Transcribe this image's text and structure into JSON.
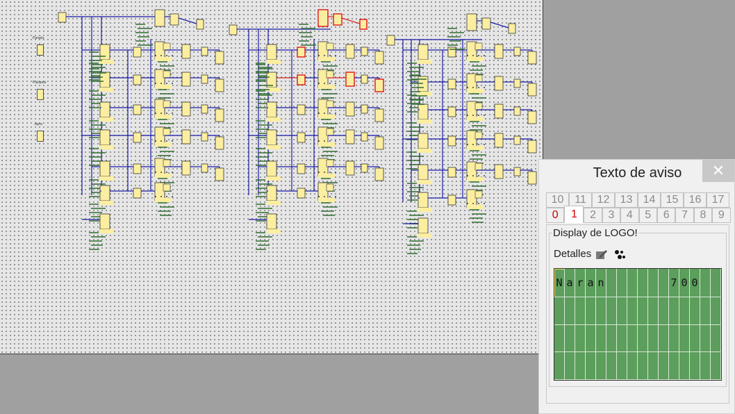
{
  "canvas": {
    "input_labels": [
      "Parada",
      "Pulsante",
      "Apoc"
    ],
    "colors": {
      "wire": "#1a1aa8",
      "active_wire": "#e02020",
      "block": "#fbeea0",
      "text": "#2e6b2e"
    }
  },
  "dialog": {
    "title": "Texto de aviso",
    "close_icon": "close-icon",
    "tabs_top": [
      "10",
      "11",
      "12",
      "13",
      "14",
      "15",
      "16",
      "17"
    ],
    "tabs_bottom": [
      "0",
      "1",
      "2",
      "3",
      "4",
      "5",
      "6",
      "7",
      "8",
      "9"
    ],
    "active_tab": "1",
    "group_label": "Display de LOGO!",
    "details_label": "Detalles",
    "lcd": {
      "rows": 4,
      "cols": 16,
      "line1": [
        "N",
        "a",
        "r",
        "a",
        "n",
        "",
        "",
        "",
        "",
        "",
        "",
        "7",
        "0",
        "0",
        "",
        ""
      ],
      "background": "#5c9e5c"
    }
  }
}
